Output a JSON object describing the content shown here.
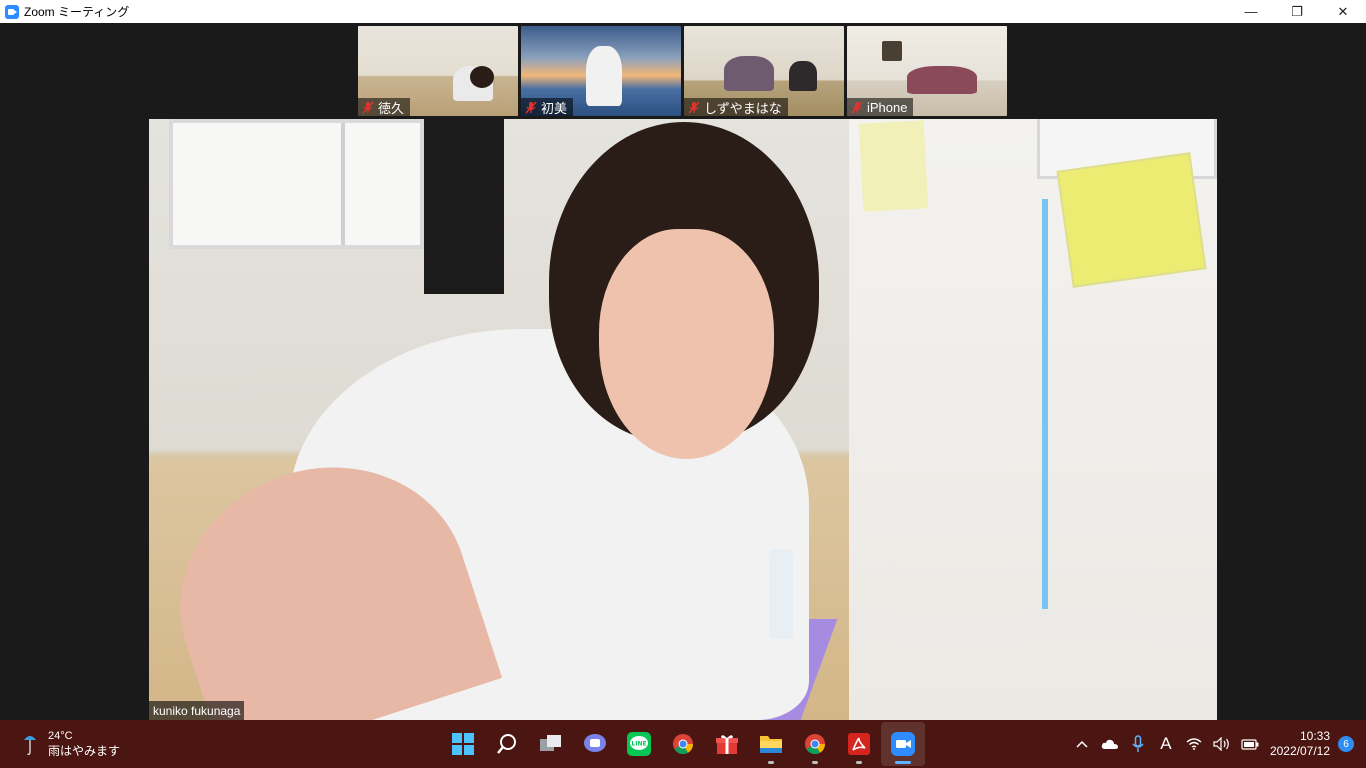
{
  "window": {
    "title": "Zoom ミーティング",
    "controls": {
      "minimize": "—",
      "restore": "❐",
      "close": "✕"
    }
  },
  "participants": [
    {
      "name": "徳久",
      "muted": true
    },
    {
      "name": "初美",
      "muted": true
    },
    {
      "name": "しずやまはな",
      "muted": true
    },
    {
      "name": "iPhone",
      "muted": true
    }
  ],
  "active_speaker": {
    "name": "kuniko fukunaga"
  },
  "taskbar": {
    "weather": {
      "temperature": "24°C",
      "condition": "雨はやみます"
    },
    "apps": [
      {
        "name": "start",
        "icon": "windows-start-icon"
      },
      {
        "name": "search",
        "icon": "search-icon"
      },
      {
        "name": "task-view",
        "icon": "task-view-icon"
      },
      {
        "name": "teams-chat",
        "icon": "chat-icon"
      },
      {
        "name": "line",
        "icon": "line-icon",
        "label": "LINE"
      },
      {
        "name": "chrome",
        "icon": "chrome-icon"
      },
      {
        "name": "gift",
        "icon": "gift-icon"
      },
      {
        "name": "file-explorer",
        "icon": "folder-icon"
      },
      {
        "name": "chrome-2",
        "icon": "chrome-icon"
      },
      {
        "name": "acrobat",
        "icon": "pdf-icon"
      },
      {
        "name": "zoom",
        "icon": "zoom-icon"
      }
    ],
    "tray": {
      "chevron": "^",
      "ime": "A",
      "clock_time": "10:33",
      "clock_date": "2022/07/12",
      "notifications": "6"
    }
  },
  "colors": {
    "zoom_blue": "#2d8cff",
    "taskbar_bg": "#4b1611",
    "stage_bg": "#1a1a1a",
    "mute_red": "#e0332f"
  }
}
